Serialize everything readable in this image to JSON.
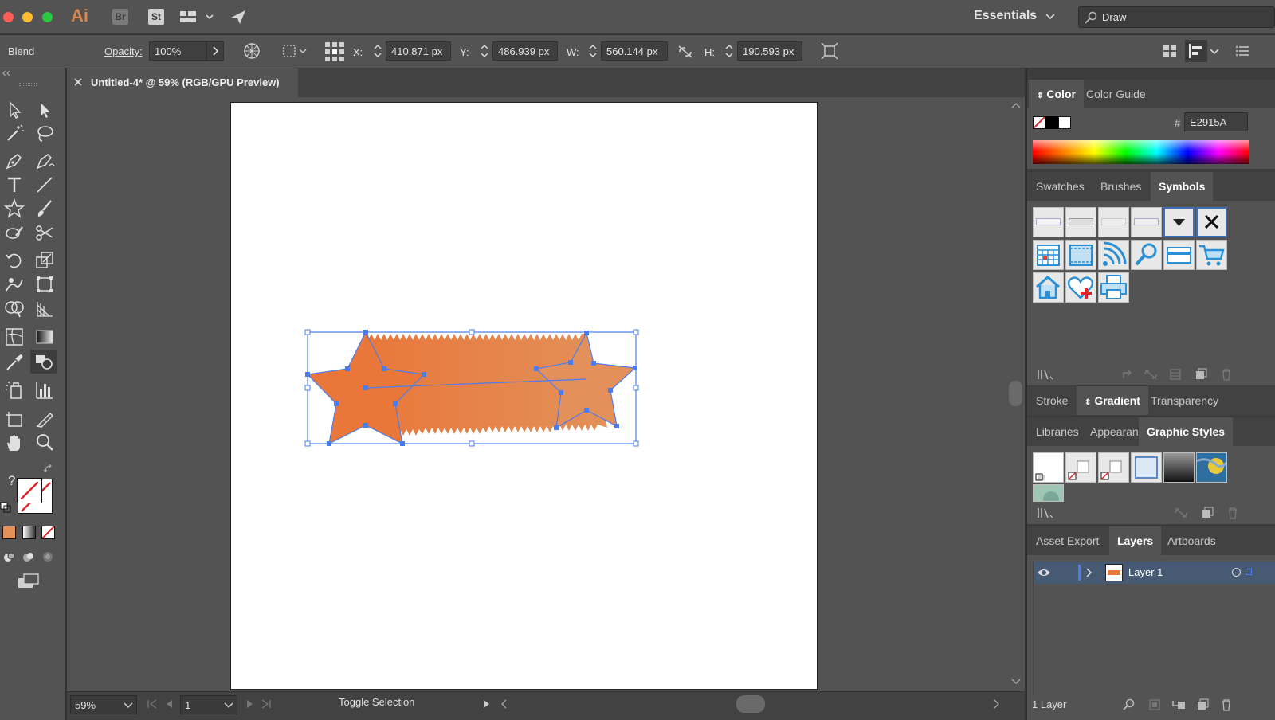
{
  "app": {
    "logo": "Ai",
    "bridge": "Br",
    "stock": "St",
    "workspace": "Essentials",
    "search_value": "Draw"
  },
  "controlbar": {
    "selection_type": "Blend",
    "opacity_label": "Opacity:",
    "opacity_value": "100%",
    "x_label": "X:",
    "x_value": "410.871 px",
    "y_label": "Y:",
    "y_value": "486.939 px",
    "w_label": "W:",
    "w_value": "560.144 px",
    "h_label": "H:",
    "h_value": "190.593 px"
  },
  "document": {
    "tab_title": "Untitled-4* @ 59% (RGB/GPU Preview)"
  },
  "statusbar": {
    "zoom": "59%",
    "artboard_number": "1",
    "status_text": "Toggle Selection"
  },
  "panels": {
    "color": {
      "tabs": [
        "Color",
        "Color Guide"
      ],
      "hex_label": "#",
      "hex_value": "E2915A"
    },
    "library_tabs": [
      "Swatches",
      "Brushes",
      "Symbols"
    ],
    "appearance_tabs": [
      "Stroke",
      "Gradient",
      "Transparency"
    ],
    "styles_tabs": [
      "Libraries",
      "Appearan",
      "Graphic Styles"
    ],
    "layer_tabs": [
      "Asset Export",
      "Layers",
      "Artboards"
    ],
    "layers": [
      {
        "name": "Layer 1"
      }
    ],
    "layer_count": "1 Layer"
  },
  "colors": {
    "fill": "#e2915a",
    "selection": "#4a7cf0",
    "star_dark": "#e9773a"
  }
}
